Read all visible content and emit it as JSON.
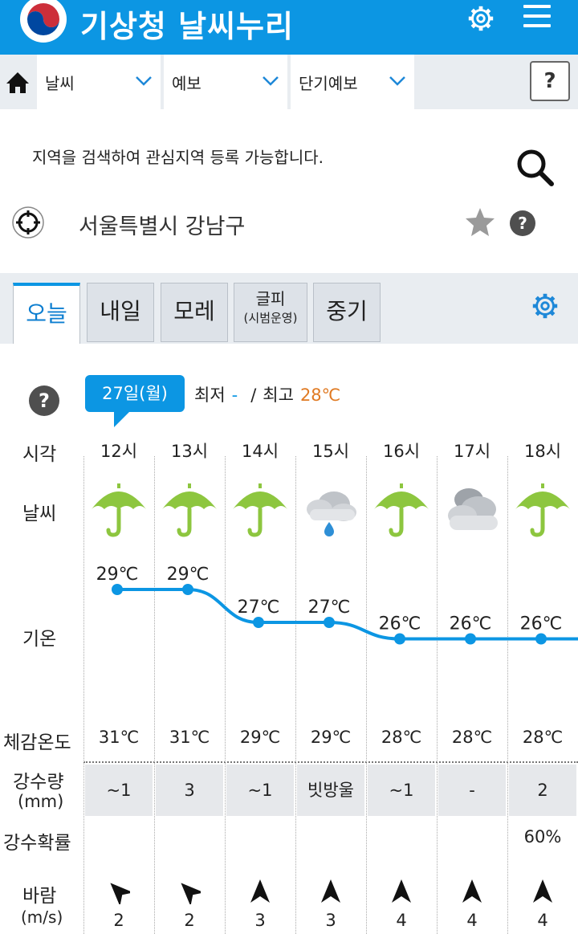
{
  "header": {
    "title": "기상청 날씨누리",
    "brand_color": "#0c96e3"
  },
  "breadcrumb": {
    "items": [
      {
        "label": "날씨"
      },
      {
        "label": "예보"
      },
      {
        "label": "단기예보"
      }
    ],
    "help": "?"
  },
  "search": {
    "hint": "지역을 검색하여 관심지역 등록 가능합니다."
  },
  "location": {
    "name": "서울특별시 강남구"
  },
  "tabs": [
    {
      "label": "오늘",
      "active": true
    },
    {
      "label": "내일"
    },
    {
      "label": "모레"
    },
    {
      "label": "글피",
      "sub": "(시범운영)"
    },
    {
      "label": "중기"
    }
  ],
  "forecast": {
    "date": "27일(월)",
    "min_label": "최저",
    "min_value": "-",
    "separator": "/",
    "max_label": "최고",
    "max_value": "28℃",
    "help": "?",
    "row_labels": {
      "time": "시각",
      "weather": "날씨",
      "temp": "기온",
      "feels": "체감온도",
      "precip": "강수량",
      "precip_unit": "(mm)",
      "prob": "강수확률",
      "wind": "바람",
      "wind_unit": "(m/s)"
    },
    "hours": [
      {
        "time": "12시",
        "icon": "umbrella-icon",
        "temp": "29℃",
        "feels": "31℃",
        "precip": "~1",
        "prob": "",
        "wind": "2",
        "wind_dir": "nw"
      },
      {
        "time": "13시",
        "icon": "umbrella-icon",
        "temp": "29℃",
        "feels": "31℃",
        "precip": "3",
        "prob": "",
        "wind": "2",
        "wind_dir": "nw"
      },
      {
        "time": "14시",
        "icon": "umbrella-icon",
        "temp": "27℃",
        "feels": "29℃",
        "precip": "~1",
        "prob": "",
        "wind": "3",
        "wind_dir": "n"
      },
      {
        "time": "15시",
        "icon": "cloud-rain-icon",
        "temp": "27℃",
        "feels": "29℃",
        "precip": "빗방울",
        "prob": "",
        "wind": "3",
        "wind_dir": "n"
      },
      {
        "time": "16시",
        "icon": "umbrella-icon",
        "temp": "26℃",
        "feels": "28℃",
        "precip": "~1",
        "prob": "",
        "wind": "4",
        "wind_dir": "n"
      },
      {
        "time": "17시",
        "icon": "cloud-icon",
        "temp": "26℃",
        "feels": "28℃",
        "precip": "-",
        "prob": "",
        "wind": "4",
        "wind_dir": "n"
      },
      {
        "time": "18시",
        "icon": "umbrella-icon",
        "temp": "26℃",
        "feels": "28℃",
        "precip": "2",
        "prob": "60%",
        "wind": "4",
        "wind_dir": "n"
      }
    ]
  },
  "chart_data": {
    "type": "line",
    "categories": [
      "12시",
      "13시",
      "14시",
      "15시",
      "16시",
      "17시",
      "18시"
    ],
    "series": [
      {
        "values": [
          29,
          29,
          27,
          27,
          26,
          26,
          26
        ]
      }
    ],
    "line_color": "#0c96e3"
  }
}
